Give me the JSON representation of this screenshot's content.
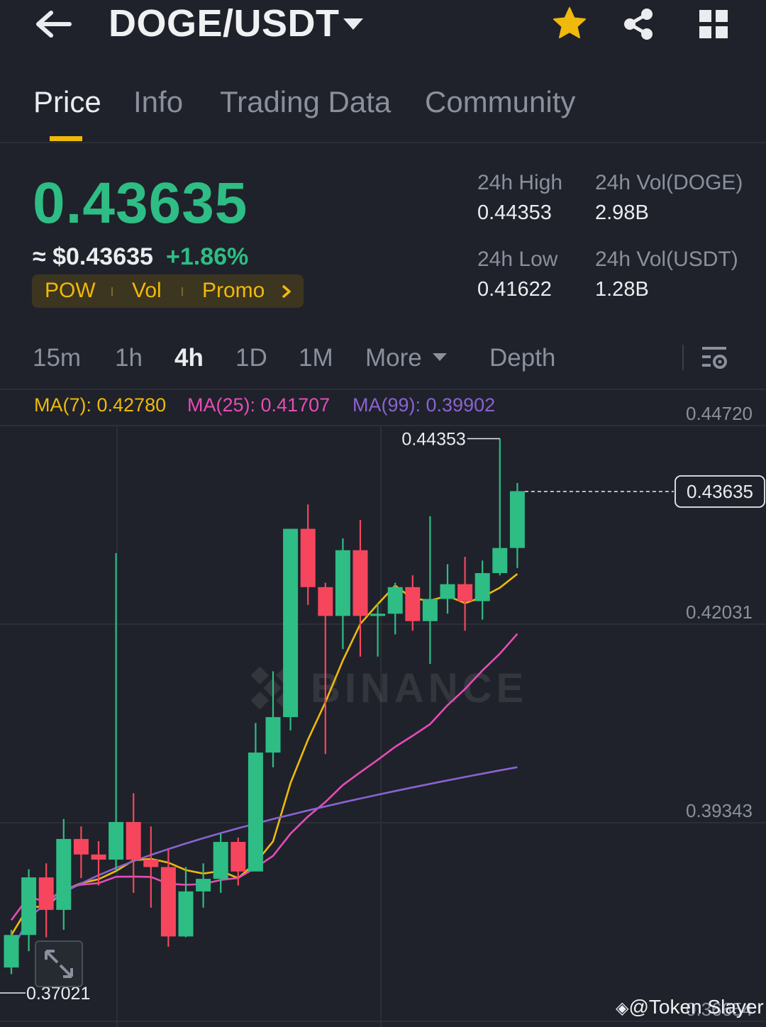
{
  "header": {
    "pair": "DOGE/USDT",
    "icons": [
      "back-arrow-icon",
      "caret-down-icon",
      "star-icon",
      "share-icon",
      "grid-icon"
    ]
  },
  "tabs": [
    {
      "label": "Price",
      "active": true
    },
    {
      "label": "Info",
      "active": false
    },
    {
      "label": "Trading Data",
      "active": false
    },
    {
      "label": "Community",
      "active": false
    }
  ],
  "price": {
    "last": "0.43635",
    "approx": "≈ $0.43635",
    "change": "+1.86%",
    "tags": [
      "POW",
      "Vol",
      "Promo"
    ],
    "stats": {
      "high_label": "24h High",
      "high": "0.44353",
      "low_label": "24h Low",
      "low": "0.41622",
      "vol_base_label": "24h Vol(DOGE)",
      "vol_base": "2.98B",
      "vol_quote_label": "24h Vol(USDT)",
      "vol_quote": "1.28B"
    }
  },
  "intervals": {
    "items": [
      "15m",
      "1h",
      "4h",
      "1D",
      "1M",
      "More",
      "Depth"
    ],
    "active": "4h"
  },
  "ma_legend": {
    "ma7": "MA(7): 0.42780",
    "ma25": "MA(25): 0.41707",
    "ma99": "MA(99): 0.39902"
  },
  "colors": {
    "up": "#2ebd85",
    "down": "#f6465d",
    "accent": "#f0b90b",
    "ma7": "#f0b90b",
    "ma25": "#e64cb8",
    "ma99": "#8a63d2"
  },
  "chart_data": {
    "type": "candlestick",
    "y_axis_labels": [
      "0.44720",
      "0.42031",
      "0.39343",
      "0.36654"
    ],
    "high_marker": "0.44353",
    "low_marker": "0.37021",
    "last_price_marker": "0.43635",
    "watermark": "BINANCE",
    "candles": [
      [
        0.3719,
        0.3763,
        0.377,
        0.371
      ],
      [
        0.3763,
        0.3841,
        0.3852,
        0.3741
      ],
      [
        0.3841,
        0.3797,
        0.386,
        0.376
      ],
      [
        0.3797,
        0.3893,
        0.392,
        0.377
      ],
      [
        0.3893,
        0.3872,
        0.391,
        0.384
      ],
      [
        0.3872,
        0.3865,
        0.389,
        0.383
      ],
      [
        0.3865,
        0.3916,
        0.428,
        0.385
      ],
      [
        0.3916,
        0.3865,
        0.3955,
        0.382
      ],
      [
        0.3865,
        0.3855,
        0.391,
        0.38
      ],
      [
        0.3855,
        0.3761,
        0.388,
        0.3747
      ],
      [
        0.3761,
        0.3822,
        0.3855,
        0.376
      ],
      [
        0.3822,
        0.3839,
        0.386,
        0.38
      ],
      [
        0.3839,
        0.3889,
        0.39,
        0.382
      ],
      [
        0.3889,
        0.3849,
        0.3895,
        0.383
      ],
      [
        0.3849,
        0.401,
        0.405,
        0.385
      ],
      [
        0.401,
        0.4058,
        0.412,
        0.399
      ],
      [
        0.4058,
        0.4313,
        0.4313,
        0.404
      ],
      [
        0.4313,
        0.4234,
        0.4346,
        0.421
      ],
      [
        0.4234,
        0.4195,
        0.424,
        0.4008
      ],
      [
        0.4195,
        0.4284,
        0.43,
        0.415
      ],
      [
        0.4284,
        0.4195,
        0.4325,
        0.414
      ],
      [
        0.4195,
        0.4198,
        0.4212,
        0.414
      ],
      [
        0.4198,
        0.4234,
        0.424,
        0.417
      ],
      [
        0.4234,
        0.4188,
        0.425,
        0.4175
      ],
      [
        0.4188,
        0.4218,
        0.433,
        0.413
      ],
      [
        0.4218,
        0.4238,
        0.4265,
        0.4198
      ],
      [
        0.4238,
        0.4215,
        0.4275,
        0.4175
      ],
      [
        0.4215,
        0.4253,
        0.427,
        0.419
      ],
      [
        0.4253,
        0.4287,
        0.4435,
        0.425
      ],
      [
        0.4287,
        0.4364,
        0.4375,
        0.426
      ]
    ]
  }
}
